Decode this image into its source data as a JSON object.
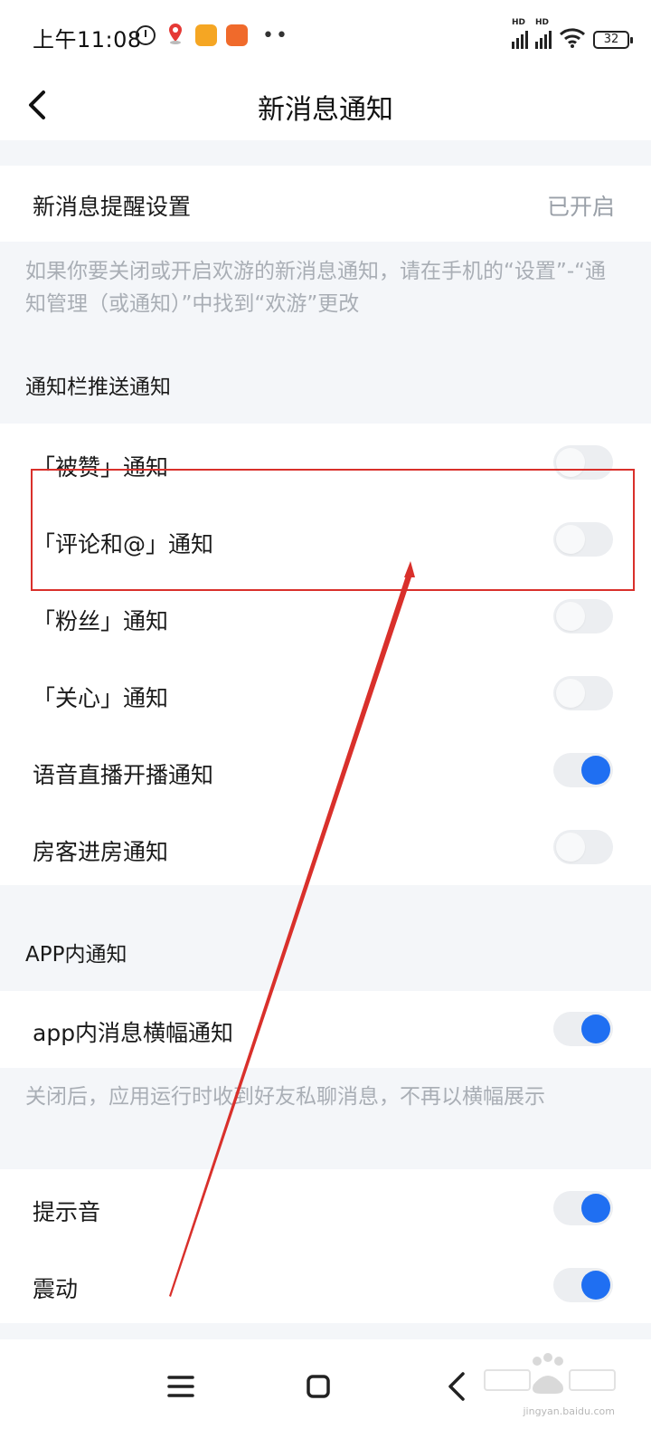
{
  "status_bar": {
    "time": "上午11:08",
    "battery": "32",
    "icons": [
      "alarm-icon",
      "map-pin-app-icon",
      "notes-app-icon",
      "app-icon",
      "hd-signal-icon",
      "hd-signal-icon",
      "wifi-icon",
      "battery-icon"
    ]
  },
  "header": {
    "title": "新消息通知"
  },
  "reminder": {
    "label": "新消息提醒设置",
    "value": "已开启"
  },
  "reminder_hint": "如果你要关闭或开启欢游的新消息通知，请在手机的“设置”-“通知管理（或通知）”中找到“欢游”更改",
  "push_section": {
    "title": "通知栏推送通知",
    "items": [
      {
        "label": "「被赞」通知",
        "on": false
      },
      {
        "label": "「评论和@」通知",
        "on": false
      },
      {
        "label": "「粉丝」通知",
        "on": false
      },
      {
        "label": "「关心」通知",
        "on": false
      },
      {
        "label": "语音直播开播通知",
        "on": true
      },
      {
        "label": "房客进房通知",
        "on": false
      }
    ]
  },
  "app_section": {
    "title": "APP内通知",
    "banner": {
      "label": "app内消息横幅通知",
      "on": true
    },
    "hint": "关闭后，应用运行时收到好友私聊消息，不再以横幅展示",
    "sound": {
      "label": "提示音",
      "on": true
    },
    "vibrate": {
      "label": "震动",
      "on": true
    }
  },
  "colors": {
    "accent": "#1f6ff2",
    "annotation": "#d9302b",
    "background": "#f4f6f9"
  },
  "watermark": {
    "text": "jingyan.baidu.com"
  }
}
